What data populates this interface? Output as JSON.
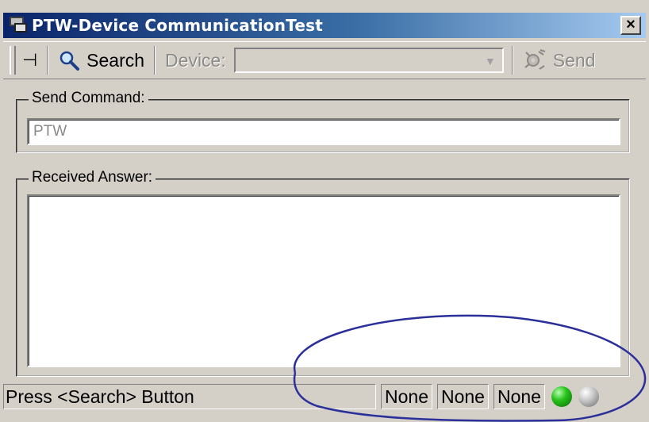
{
  "window": {
    "title": "PTW-Device CommunicationTest",
    "close_label": "×"
  },
  "toolbar": {
    "search_label": "Search",
    "device_label": "Device:",
    "device_value": "",
    "send_label": "Send"
  },
  "send_command": {
    "label": "Send Command:",
    "value": "PTW"
  },
  "received_answer": {
    "label": "Received Answer:",
    "value": ""
  },
  "status": {
    "message": "Press <Search> Button",
    "cells": [
      "None",
      "None",
      "None"
    ],
    "led_colors": [
      "#27c21b",
      "#a0a0a0"
    ]
  },
  "annotation": {
    "color": "#2b2f9a"
  }
}
